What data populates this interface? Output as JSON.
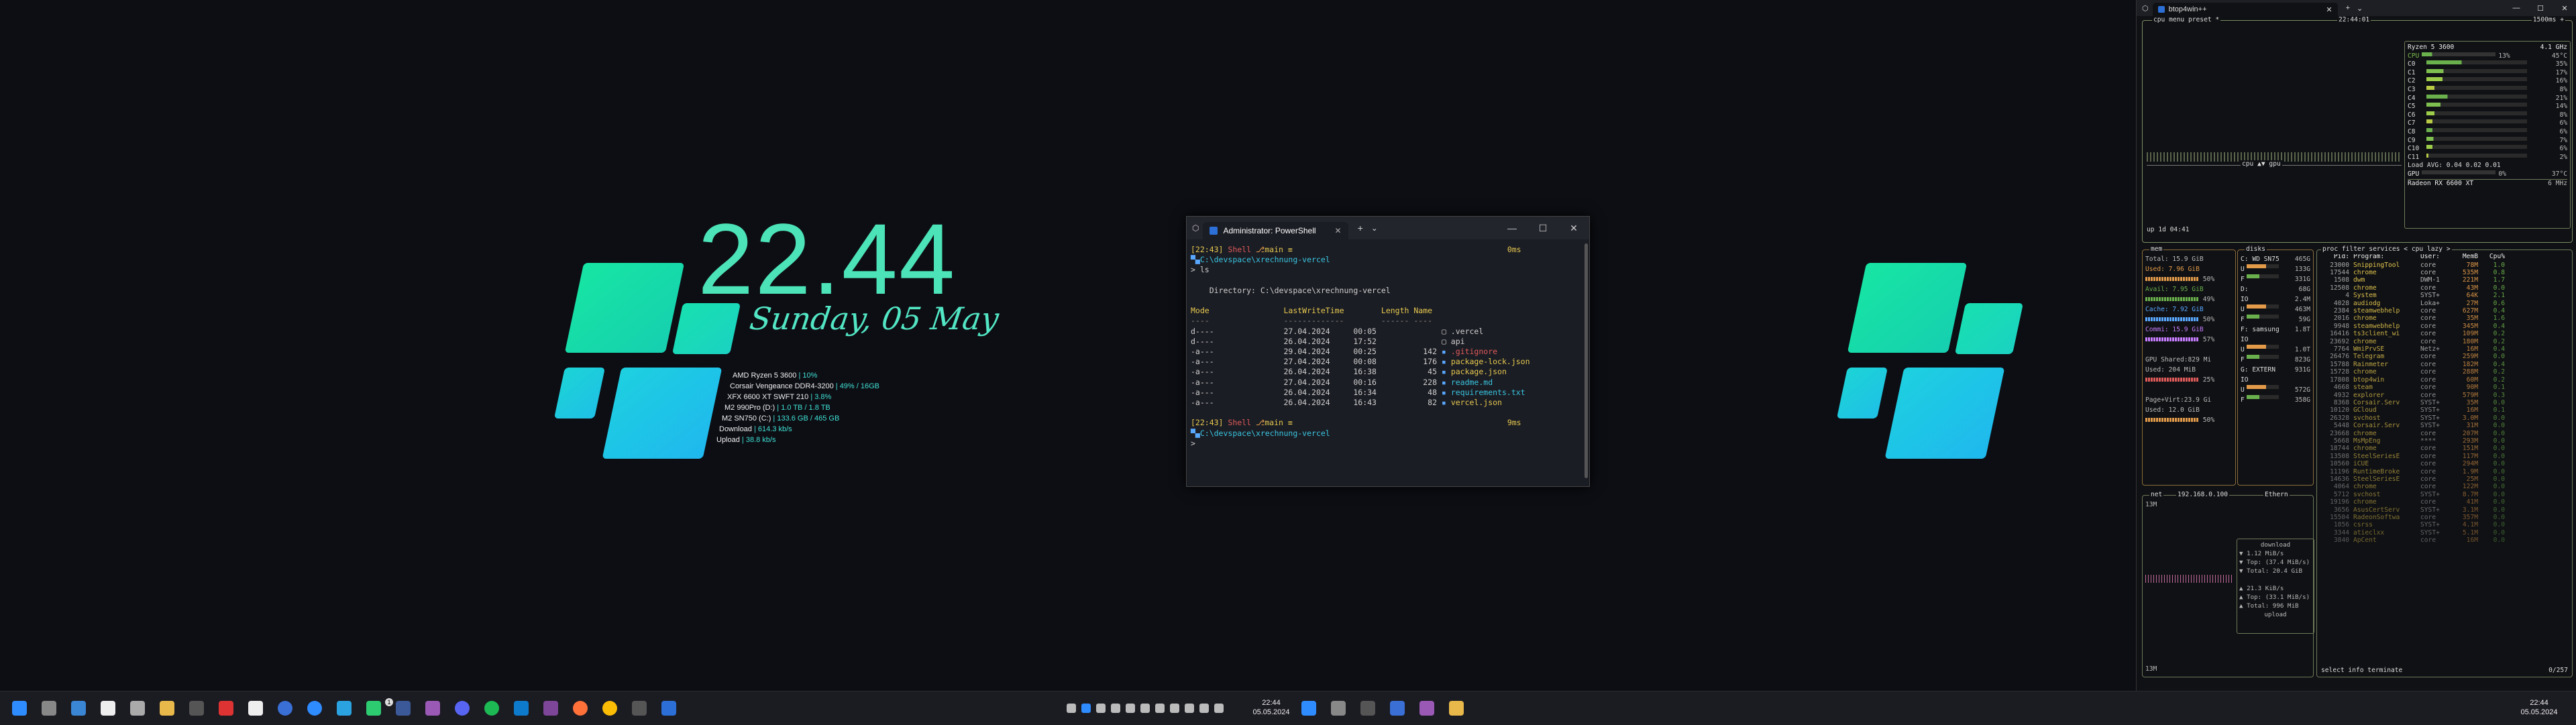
{
  "desktop_widget": {
    "clock": "22.44",
    "date": "Sunday, 05 May",
    "specs": [
      {
        "label": "AMD Ryzen 5 3600",
        "value": "10%"
      },
      {
        "label": "Corsair Vengeance DDR4-3200",
        "value": "49% / 16GB"
      },
      {
        "label": "XFX 6600 XT SWFT 210",
        "value": "3.8%"
      },
      {
        "label": "M2 990Pro (D:)",
        "value": "1.0 TB / 1.8 TB"
      },
      {
        "label": "M2 SN750 (C:)",
        "value": "133.6 GB / 465 GB"
      },
      {
        "label": "Download",
        "value": "614.3 kb/s"
      },
      {
        "label": "Upload",
        "value": "38.8 kb/s"
      }
    ],
    "accent_colors": [
      "#17e6a3",
      "#1fc6e8",
      "#4be3b7"
    ]
  },
  "terminal": {
    "tab_title": "Administrator: PowerShell",
    "add_tab": "+",
    "dropdown": "⌄",
    "minimize": "—",
    "maximize": "☐",
    "close": "✕",
    "prompt1_time": "[22:43]",
    "prompt1_shell": "Shell",
    "prompt1_branch": "main",
    "prompt1_symbol": "≡",
    "prompt1_dur": "0ms",
    "path": "C:\\devspace\\xrechnung-vercel",
    "cmd": "> ls",
    "directory_line": "    Directory: C:\\devspace\\xrechnung-vercel",
    "headers": [
      "Mode",
      "LastWriteTime",
      "Length",
      "Name"
    ],
    "files": [
      {
        "mode": "d----",
        "date": "27.04.2024",
        "time": "00:05",
        "length": "",
        "name": ".vercel"
      },
      {
        "mode": "d----",
        "date": "26.04.2024",
        "time": "17:52",
        "length": "",
        "name": "api"
      },
      {
        "mode": "-a---",
        "date": "29.04.2024",
        "time": "00:25",
        "length": "142",
        "name": ".gitignore"
      },
      {
        "mode": "-a---",
        "date": "27.04.2024",
        "time": "00:08",
        "length": "176",
        "name": "package-lock.json"
      },
      {
        "mode": "-a---",
        "date": "26.04.2024",
        "time": "16:38",
        "length": "45",
        "name": "package.json"
      },
      {
        "mode": "-a---",
        "date": "27.04.2024",
        "time": "00:16",
        "length": "228",
        "name": "readme.md"
      },
      {
        "mode": "-a---",
        "date": "26.04.2024",
        "time": "16:34",
        "length": "48",
        "name": "requirements.txt"
      },
      {
        "mode": "-a---",
        "date": "26.04.2024",
        "time": "16:43",
        "length": "82",
        "name": "vercel.json"
      }
    ],
    "prompt2_time": "[22:43]",
    "prompt2_dur": "9ms",
    "cursor_line": "> "
  },
  "btop": {
    "tab_title": "btop4win++",
    "cpu_header": "cpu  menu  preset *",
    "time": "22:44:01",
    "interval": "1500ms +",
    "cpu_model": "Ryzen 5 3600",
    "cpu_freq": "4.1 GHz",
    "cpu_total": {
      "name": "CPU",
      "pct": "13%",
      "temp": "45°C"
    },
    "cores": [
      {
        "name": "C0",
        "pct": "35%"
      },
      {
        "name": "C1",
        "pct": "17%"
      },
      {
        "name": "C2",
        "pct": "16%"
      },
      {
        "name": "C3",
        "pct": "8%"
      },
      {
        "name": "C4",
        "pct": "21%"
      },
      {
        "name": "C5",
        "pct": "14%"
      },
      {
        "name": "C6",
        "pct": "8%"
      },
      {
        "name": "C7",
        "pct": "6%"
      },
      {
        "name": "C8",
        "pct": "6%"
      },
      {
        "name": "C9",
        "pct": "7%"
      },
      {
        "name": "C10",
        "pct": "6%"
      },
      {
        "name": "C11",
        "pct": "2%"
      }
    ],
    "load_avg": "Load AVG:  0.04  0.02  0.01",
    "gpu_row": "GPU",
    "gpu_pct": "0%",
    "gpu_temp": "37°C",
    "gpu_name": "Radeon RX 6600 XT",
    "gpu_freq": "6 MHz",
    "cpu_gpu_label": "cpu ▲▼ gpu",
    "uptime": "up 1d 04:41",
    "mem": {
      "label": "mem",
      "total": "Total:   15.9 GiB",
      "used": "Used:    7.96 GiB",
      "used_pct": "50%",
      "avail": "Avail:   7.95 GiB",
      "avail_pct": "49%",
      "cache": "Cache:   7.92 GiB",
      "cache_pct": "50%",
      "commit": "Commi:  15.9 GiB",
      "commit_pct": "57%",
      "gpu_shared": "GPU Shared:829 Mi",
      "gpu_used": "Used:   204 MiB",
      "gpu_pct": "25%",
      "pagevirt": "Page+Virt:23.9 Gi",
      "pv_used": "Used:   12.0 GiB",
      "pv_pct": "50%"
    },
    "disks": {
      "label": "disks",
      "entries": [
        {
          "name": "C: WD SN75",
          "size": "465G",
          "io": "1.2M"
        },
        {
          "name": "U",
          "size": "133G"
        },
        {
          "name": "F",
          "size": "331G"
        },
        {
          "name": "D: ",
          "size": "68G"
        },
        {
          "name": "IO",
          "size": "2.4M"
        },
        {
          "name": "U",
          "size": "463M"
        },
        {
          "name": "F",
          "size": "59G"
        },
        {
          "name": "F: samsung",
          "size": "1.8T"
        },
        {
          "name": "IO",
          "size": ""
        },
        {
          "name": "U",
          "size": "1.0T"
        },
        {
          "name": "F",
          "size": "823G"
        },
        {
          "name": "G: EXTERN",
          "size": "931G"
        },
        {
          "name": "IO",
          "size": ""
        },
        {
          "name": "U",
          "size": "572G"
        },
        {
          "name": "F",
          "size": "358G"
        }
      ]
    },
    "net": {
      "label": "net",
      "ip": "192.168.0.100",
      "iface": "Ethern",
      "scale_top": "13M",
      "scale_bottom": "13M",
      "download": "download",
      "dl_rate": "1.12 MiB/s",
      "dl_top": "Top: (37.4 MiB/s)",
      "dl_total": "Total: 20.4 GiB",
      "ul_rate": "21.3 KiB/s",
      "ul_top": "Top: (33.1 MiB/s)",
      "ul_total": "Total:  996 MiB",
      "upload": "upload"
    },
    "proc": {
      "header": "proc  filter  services  < cpu lazy >",
      "columns": [
        "Pid:",
        "Program:",
        "User:",
        "MemB",
        "Cpu%"
      ],
      "rows": [
        {
          "pid": "23000",
          "prog": "SnippingTool",
          "user": "core",
          "mem": "78M",
          "cpu": "1.0"
        },
        {
          "pid": "17544",
          "prog": "chrome",
          "user": "core",
          "mem": "535M",
          "cpu": "0.8"
        },
        {
          "pid": "1508",
          "prog": "dwm",
          "user": "DWM-1",
          "mem": "221M",
          "cpu": "1.7"
        },
        {
          "pid": "12508",
          "prog": "chrome",
          "user": "core",
          "mem": "43M",
          "cpu": "0.0"
        },
        {
          "pid": "4",
          "prog": "System",
          "user": "SYST+",
          "mem": "64K",
          "cpu": "2.1"
        },
        {
          "pid": "4028",
          "prog": "audiodg",
          "user": "Loka+",
          "mem": "27M",
          "cpu": "0.6"
        },
        {
          "pid": "2384",
          "prog": "steamwebhelp",
          "user": "core",
          "mem": "627M",
          "cpu": "0.4"
        },
        {
          "pid": "2016",
          "prog": "chrome",
          "user": "core",
          "mem": "35M",
          "cpu": "1.6"
        },
        {
          "pid": "9948",
          "prog": "steamwebhelp",
          "user": "core",
          "mem": "345M",
          "cpu": "0.4"
        },
        {
          "pid": "16416",
          "prog": "ts3client_wi",
          "user": "core",
          "mem": "109M",
          "cpu": "0.2"
        },
        {
          "pid": "23692",
          "prog": "chrome",
          "user": "core",
          "mem": "180M",
          "cpu": "0.2"
        },
        {
          "pid": "7764",
          "prog": "WmiPrvSE",
          "user": "Netz+",
          "mem": "16M",
          "cpu": "0.4"
        },
        {
          "pid": "26476",
          "prog": "Telegram",
          "user": "core",
          "mem": "259M",
          "cpu": "0.0"
        },
        {
          "pid": "15788",
          "prog": "Rainmeter",
          "user": "core",
          "mem": "182M",
          "cpu": "0.4"
        },
        {
          "pid": "15728",
          "prog": "chrome",
          "user": "core",
          "mem": "288M",
          "cpu": "0.2"
        },
        {
          "pid": "17808",
          "prog": "btop4win",
          "user": "core",
          "mem": "60M",
          "cpu": "0.2"
        },
        {
          "pid": "4668",
          "prog": "steam",
          "user": "core",
          "mem": "90M",
          "cpu": "0.1"
        },
        {
          "pid": "4932",
          "prog": "explorer",
          "user": "core",
          "mem": "579M",
          "cpu": "0.3"
        },
        {
          "pid": "8368",
          "prog": "Corsair.Serv",
          "user": "SYST+",
          "mem": "35M",
          "cpu": "0.0"
        },
        {
          "pid": "10120",
          "prog": "GCloud",
          "user": "SYST+",
          "mem": "16M",
          "cpu": "0.1"
        },
        {
          "pid": "26328",
          "prog": "svchost",
          "user": "SYST+",
          "mem": "3.0M",
          "cpu": "0.0"
        },
        {
          "pid": "5448",
          "prog": "Corsair.Serv",
          "user": "SYST+",
          "mem": "31M",
          "cpu": "0.0"
        },
        {
          "pid": "23668",
          "prog": "chrome",
          "user": "core",
          "mem": "207M",
          "cpu": "0.0"
        },
        {
          "pid": "5668",
          "prog": "MsMpEng",
          "user": "****",
          "mem": "293M",
          "cpu": "0.0"
        },
        {
          "pid": "18744",
          "prog": "chrome",
          "user": "core",
          "mem": "151M",
          "cpu": "0.0"
        },
        {
          "pid": "13508",
          "prog": "SteelSeriesE",
          "user": "core",
          "mem": "117M",
          "cpu": "0.0"
        },
        {
          "pid": "10560",
          "prog": "iCUE",
          "user": "core",
          "mem": "294M",
          "cpu": "0.0"
        },
        {
          "pid": "11196",
          "prog": "RuntimeBroke",
          "user": "core",
          "mem": "1.9M",
          "cpu": "0.0"
        },
        {
          "pid": "14636",
          "prog": "SteelSeriesE",
          "user": "core",
          "mem": "25M",
          "cpu": "0.0"
        },
        {
          "pid": "4064",
          "prog": "chrome",
          "user": "core",
          "mem": "122M",
          "cpu": "0.0"
        },
        {
          "pid": "5712",
          "prog": "svchost",
          "user": "SYST+",
          "mem": "8.7M",
          "cpu": "0.0"
        },
        {
          "pid": "19196",
          "prog": "chrome",
          "user": "core",
          "mem": "41M",
          "cpu": "0.0"
        },
        {
          "pid": "3656",
          "prog": "AsusCertServ",
          "user": "SYST+",
          "mem": "3.1M",
          "cpu": "0.0"
        },
        {
          "pid": "15504",
          "prog": "RadeonSoftwa",
          "user": "core",
          "mem": "357M",
          "cpu": "0.0"
        },
        {
          "pid": "1856",
          "prog": "csrss",
          "user": "SYST+",
          "mem": "4.1M",
          "cpu": "0.0"
        },
        {
          "pid": "3344",
          "prog": "atieclxx",
          "user": "SYST+",
          "mem": "5.1M",
          "cpu": "0.0"
        },
        {
          "pid": "3840",
          "prog": "ApCent",
          "user": "core",
          "mem": "16M",
          "cpu": "0.0"
        }
      ],
      "footer": "select  info  terminate",
      "count": "0/257"
    }
  },
  "taskbar": {
    "clock_left_time": "22:44",
    "clock_left_date": "05.05.2024",
    "clock_right_time": "22:44",
    "clock_right_date": "05.05.2024",
    "notification_badge": "1"
  }
}
